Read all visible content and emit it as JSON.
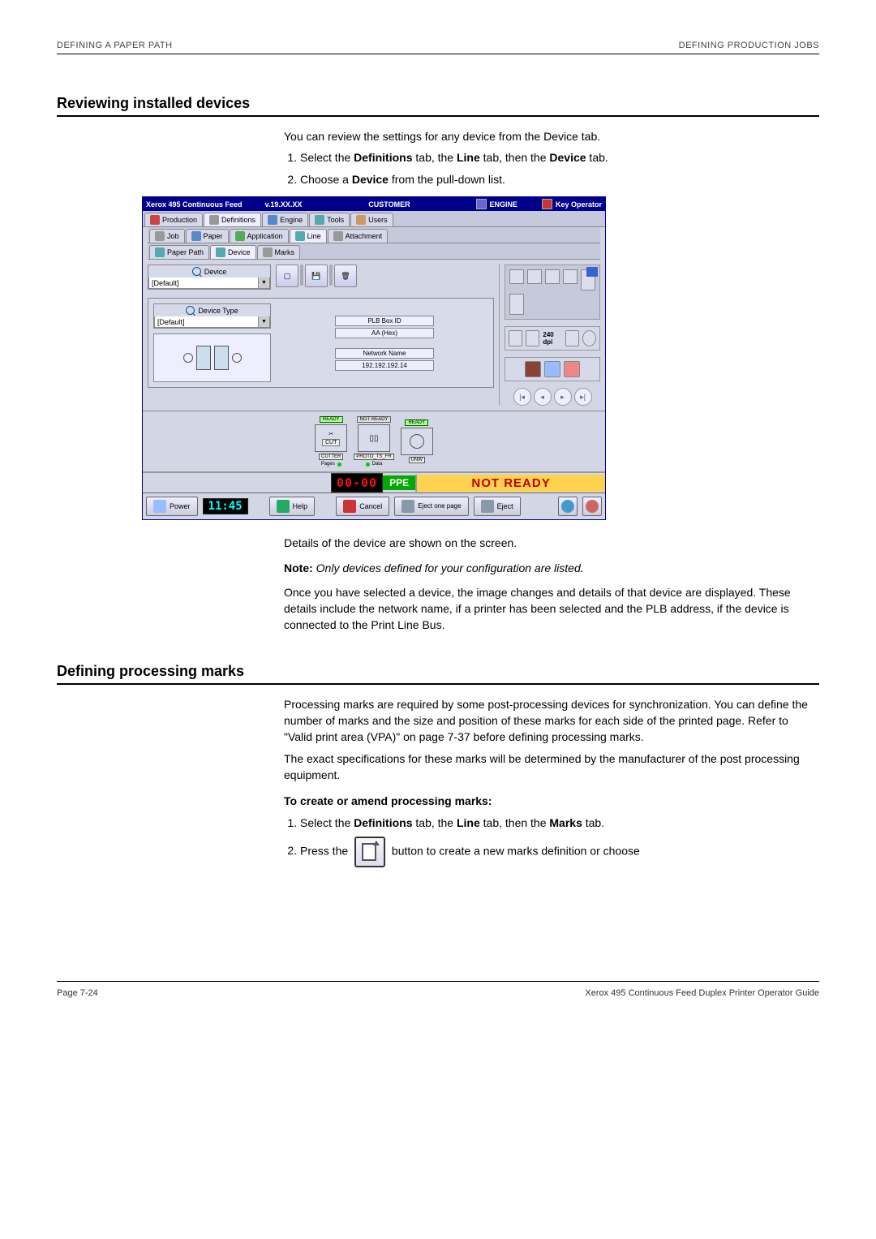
{
  "header": {
    "left": "DEFINING A PAPER PATH",
    "right": "DEFINING PRODUCTION JOBS"
  },
  "section1": {
    "title": "Reviewing installed devices",
    "intro": "You can review the settings for any device from the Device tab.",
    "step1_pre": "Select the ",
    "step1_b1": "Definitions",
    "step1_mid1": " tab, the ",
    "step1_b2": "Line",
    "step1_mid2": " tab, then the ",
    "step1_b3": "Device",
    "step1_end": " tab.",
    "step2_pre": "Choose a ",
    "step2_b": "Device",
    "step2_end": " from the pull-down list.",
    "after1": "Details of the device are shown on the screen.",
    "note_label": "Note:",
    "note_text": " Only devices defined for your configuration are listed.",
    "after2": "Once you have selected a device, the image changes and details of that device are displayed. These details include the network name, if a printer has been selected and the PLB address, if the device is connected to the Print Line Bus."
  },
  "section2": {
    "title": "Defining processing marks",
    "para1": "Processing marks are required by some post-processing devices for synchronization. You can define the number of marks and the size and position of these marks for each side of the printed page. Refer to \"Valid print area (VPA)\" on page 7-37 before defining processing marks.",
    "para2": "The exact specifications for these marks will be determined by the manufacturer of the post processing equipment.",
    "subhead": "To create or amend processing marks:",
    "s2step1_pre": "Select the ",
    "s2step1_b1": "Definitions",
    "s2step1_mid1": " tab, the ",
    "s2step1_b2": "Line",
    "s2step1_mid2": " tab, then the ",
    "s2step1_b3": "Marks",
    "s2step1_end": " tab.",
    "s2step2_pre": "Press the ",
    "s2step2_end": " button to create a new marks definition or choose"
  },
  "app": {
    "title_left": "Xerox  495 Continuous Feed",
    "version": "v.19.XX.XX",
    "title_center": "CUSTOMER",
    "engine_label": "ENGINE",
    "key_op": "Key Operator",
    "tabs_top": {
      "production": "Production",
      "definitions": "Definitions",
      "engine": "Engine",
      "tools": "Tools",
      "users": "Users"
    },
    "tabs_mid": {
      "job": "Job",
      "paper": "Paper",
      "application": "Application",
      "line": "Line",
      "attachment": "Attachment"
    },
    "tabs_low": {
      "paper_path": "Paper Path",
      "device": "Device",
      "marks": "Marks"
    },
    "device_label": "Device",
    "device_value": "[Default]",
    "device_type_label": "Device Type",
    "device_type_value": "[Default]",
    "plb_label": "PLB Box ID",
    "plb_value": "AA (Hex)",
    "net_label": "Network Name",
    "net_value": "192.192.192.14",
    "dpi": "240 dpi",
    "flow": {
      "ready": "READY",
      "not_ready": "NOT READY",
      "cut": "CUT",
      "unit_cutter": "CUTTER",
      "unit_proto": "PROTO_TS_FR",
      "unit_unw": "UNW",
      "pages": "Pages",
      "data": "Data"
    },
    "digital": "00-00",
    "ppe": "PPE",
    "status": "NOT READY",
    "bottom": {
      "power": "Power",
      "clock": "11:45",
      "help": "Help",
      "cancel": "Cancel",
      "eject_one": "Eject one page",
      "eject": "Eject"
    }
  },
  "footer": {
    "left": "Page 7-24",
    "right": "Xerox 495 Continuous Feed Duplex Printer Operator Guide"
  }
}
